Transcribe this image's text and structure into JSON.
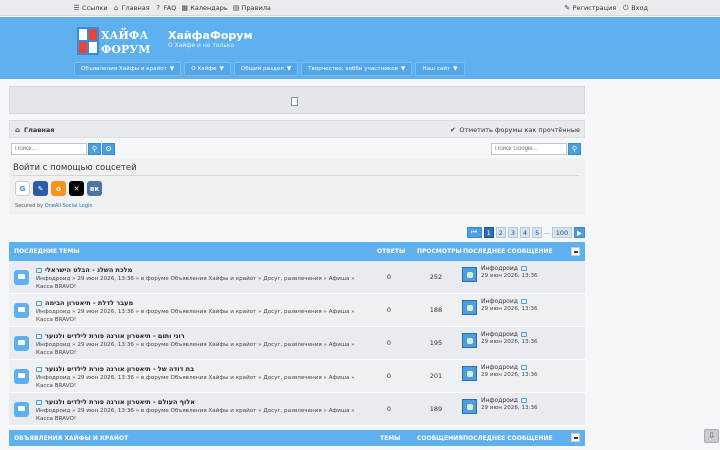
{
  "topbar": {
    "links": [
      "Ссылки",
      "Главная",
      "FAQ",
      "Календарь",
      "Правила"
    ],
    "register": "Регистрация",
    "login": "Вход"
  },
  "header": {
    "logo_top": "ХАЙФА",
    "logo_bottom": "ФОРУМ",
    "title": "ХайфаФорум",
    "subtitle": "О Хайфе и не только"
  },
  "nav": [
    "Объявления Хайфы и крайот",
    "О Хайфе",
    "Общий раздел",
    "Творчество, хобби участников",
    "Наш сайт"
  ],
  "breadcrumb": {
    "home": "Главная",
    "mark_read": "Отметить форумы как прочтённые"
  },
  "search": {
    "left_placeholder": "Поиск...",
    "google_placeholder": "Поиск Google..."
  },
  "social": {
    "title": "Войти с помощью соцсетей",
    "secured_prefix": "Secured by ",
    "secured_link": "OneAll Social Login"
  },
  "pager": {
    "pages": [
      "1",
      "2",
      "3",
      "4",
      "5"
    ],
    "ellipsis": "...",
    "last": "100"
  },
  "topics_header": {
    "title": "ПОСЛЕДНИЕ ТЕМЫ",
    "replies": "ОТВЕТЫ",
    "views": "ПРОСМОТРЫ",
    "last": "ПОСЛЕДНЕЕ СООБЩЕНИЕ"
  },
  "topics": [
    {
      "title": "מלכת השלג - הבלט הישראלי",
      "meta1": "Инфодроид » 29 июн 2026, 13:36 » в форуме Объявления Хайфы и крайот » Досуг, развлечения » Афиша »",
      "meta2": "Касса BRAVO!",
      "replies": "0",
      "views": "252",
      "user": "Инфодроид",
      "date": "29 июн 2026, 13:36"
    },
    {
      "title": "מעבר לדלת - תיאטרון הבימה",
      "meta1": "Инфодроид » 29 июн 2026, 13:36 » в форуме Объявления Хайфы и крайот » Досуг, развлечения » Афиша »",
      "meta2": "Касса BRAVO!",
      "replies": "0",
      "views": "188",
      "user": "Инфодроид",
      "date": "29 июн 2026, 13:36"
    },
    {
      "title": "רוני ותום - תיאטרון אורנה פורת לילדים ולנוער",
      "meta1": "Инфодроид » 29 июн 2026, 13:36 » в форуме Объявления Хайфы и крайот » Досуг, развлечения » Афиша »",
      "meta2": "Касса BRAVO!",
      "replies": "0",
      "views": "195",
      "user": "Инфодроид",
      "date": "29 июн 2026, 13:36"
    },
    {
      "title": "בת דודה של - תיאטרון אורנה פורת לילדים ולנוער",
      "meta1": "Инфодроид » 29 июн 2026, 13:36 » в форуме Объявления Хайфы и крайот » Досуг, развлечения » Афиша »",
      "meta2": "Касса BRAVO!",
      "replies": "0",
      "views": "201",
      "user": "Инфодроид",
      "date": "29 июн 2026, 13:36"
    },
    {
      "title": "אלוף העולם - תיאטרון אורנה פורת לילדים ולנוער",
      "meta1": "Инфодроид » 29 июн 2026, 13:36 » в форуме Объявления Хайфы и крайот » Досуг, развлечения » Афиша »",
      "meta2": "Касса BRAVO!",
      "replies": "0",
      "views": "189",
      "user": "Инфодроид",
      "date": "29 июн 2026, 13:36"
    }
  ],
  "forum_header": {
    "title": "ОБЪЯВЛЕНИЯ ХАЙФЫ И КРАЙОТ",
    "topics": "ТЕМЫ",
    "posts": "СООБЩЕНИЯ",
    "last": "ПОСЛЕДНЕЕ СООБЩЕНИЕ"
  },
  "colors": {
    "header_blue": "#5fb0ef",
    "accent": "#2a6fb0"
  }
}
